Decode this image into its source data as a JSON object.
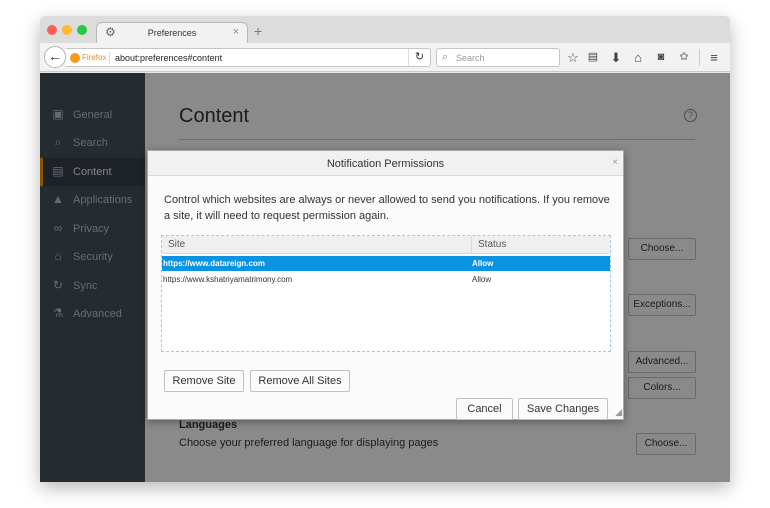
{
  "browser": {
    "tab_title": "Preferences",
    "identity_label": "Firefox",
    "url": "about:preferences#content",
    "search_placeholder": "Search",
    "toolbar_icons": [
      "bookmark-star-icon",
      "reading-list-icon",
      "downloads-icon",
      "home-icon",
      "pocket-icon",
      "extension-icon",
      "menu-icon"
    ]
  },
  "sidebar": {
    "items": [
      {
        "label": "General",
        "icon": "general-icon",
        "active": false
      },
      {
        "label": "Search",
        "icon": "search-icon",
        "active": false
      },
      {
        "label": "Content",
        "icon": "content-icon",
        "active": true
      },
      {
        "label": "Applications",
        "icon": "applications-icon",
        "active": false
      },
      {
        "label": "Privacy",
        "icon": "privacy-mask-icon",
        "active": false
      },
      {
        "label": "Security",
        "icon": "security-lock-icon",
        "active": false
      },
      {
        "label": "Sync",
        "icon": "sync-icon",
        "active": false
      },
      {
        "label": "Advanced",
        "icon": "advanced-icon",
        "active": false
      }
    ]
  },
  "main": {
    "title": "Content",
    "help": "?",
    "buttons": {
      "choose_1": "Choose...",
      "exceptions": "Exceptions...",
      "advanced": "Advanced...",
      "colors": "Colors...",
      "choose_2": "Choose..."
    },
    "languages": {
      "heading": "Languages",
      "description": "Choose your preferred language for displaying pages"
    }
  },
  "dialog": {
    "title": "Notification Permissions",
    "close": "×",
    "description": "Control which websites are always or never allowed to send you notifications. If you remove a site, it will need to request permission again.",
    "columns": [
      "Site",
      "Status"
    ],
    "rows": [
      {
        "site": "https://www.datareign.com",
        "status": "Allow",
        "selected": true
      },
      {
        "site": "https://www.kshatriyamatrimony.com",
        "status": "Allow",
        "selected": false
      }
    ],
    "remove_site": "Remove Site",
    "remove_all_sites": "Remove All Sites",
    "cancel": "Cancel",
    "save_changes": "Save Changes"
  }
}
